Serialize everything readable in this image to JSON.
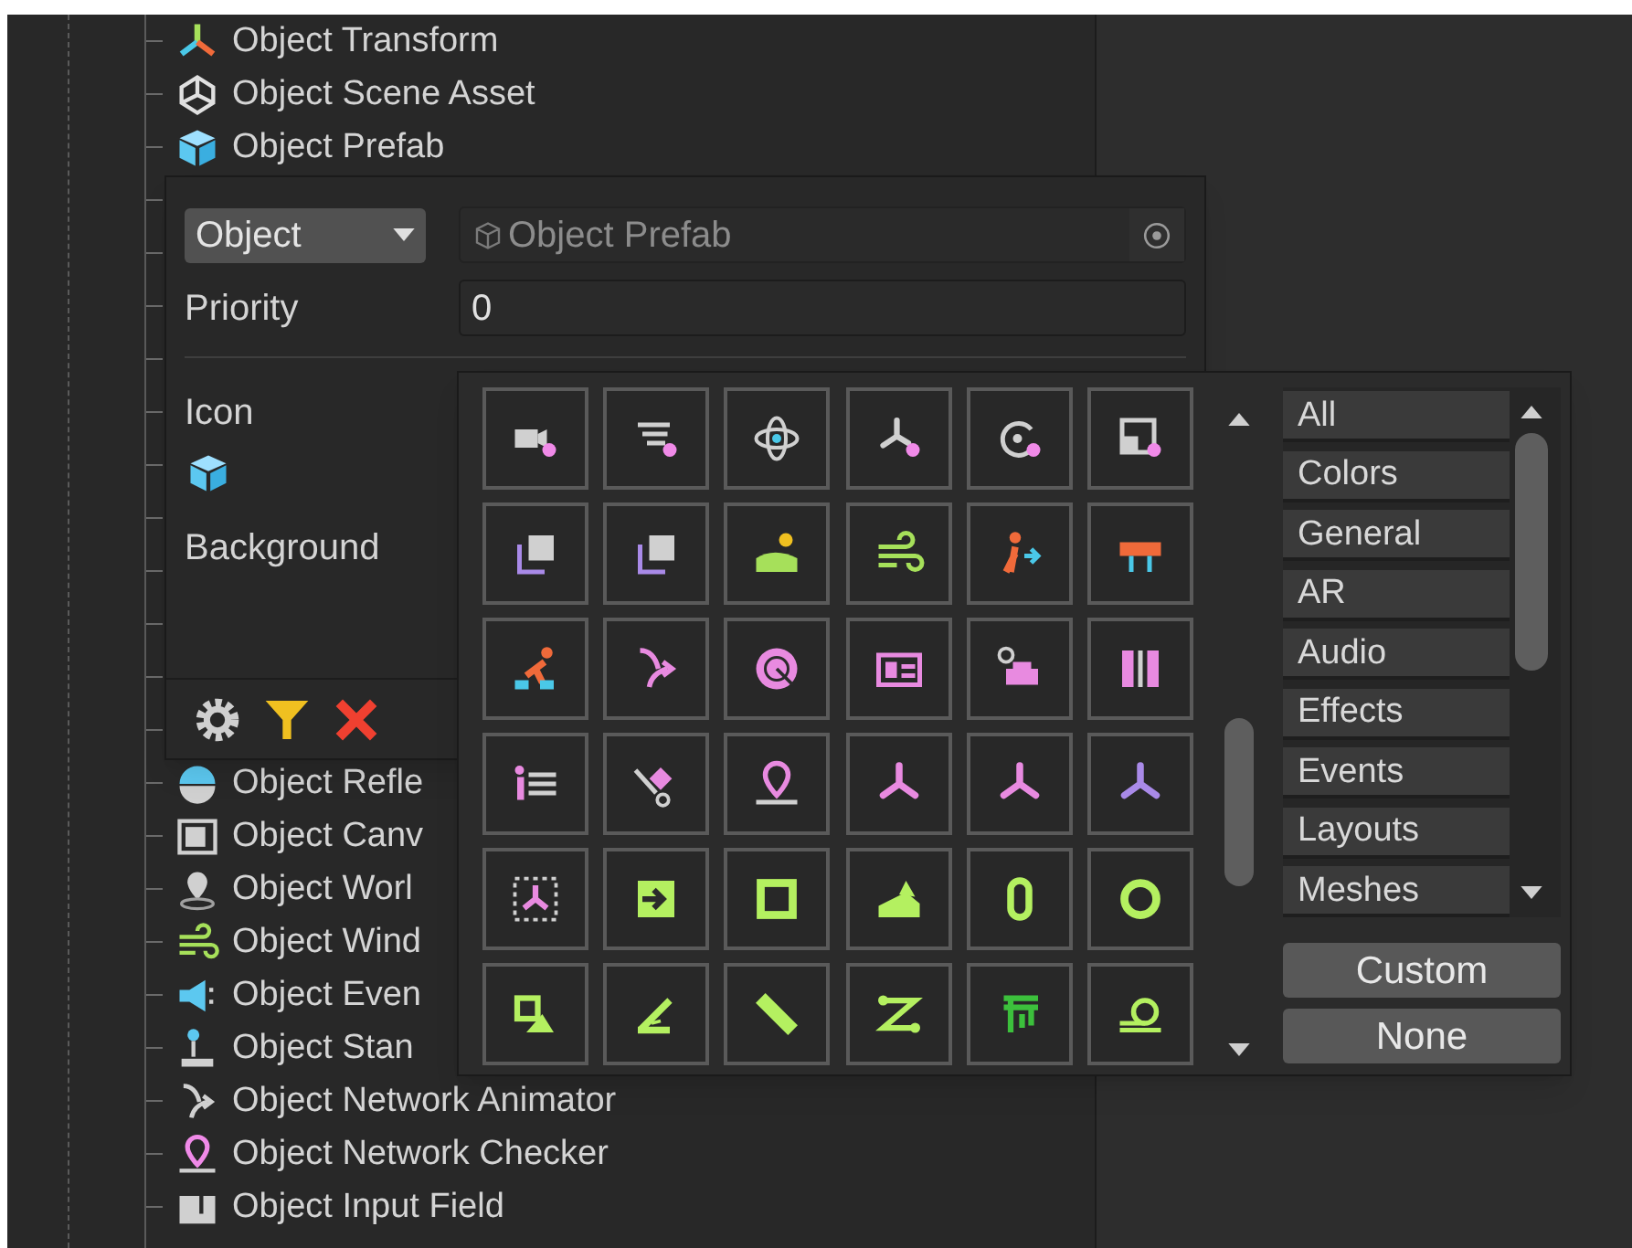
{
  "tree": {
    "rows": [
      {
        "label": "Object Transform",
        "kind": "axes"
      },
      {
        "label": "Object Scene Asset",
        "kind": "unity"
      },
      {
        "label": "Object Prefab",
        "kind": "cube"
      },
      {
        "label": "Object Refle",
        "kind": "sphere"
      },
      {
        "label": "Object Canv",
        "kind": "canvas"
      },
      {
        "label": "Object Worl",
        "kind": "worldpin"
      },
      {
        "label": "Object Wind",
        "kind": "wind"
      },
      {
        "label": "Object Even",
        "kind": "megaphone"
      },
      {
        "label": "Object Stan",
        "kind": "joystick"
      },
      {
        "label": "Object Network Animator",
        "kind": "branch"
      },
      {
        "label": "Object Network Checker",
        "kind": "mappin"
      },
      {
        "label": "Object Input Field",
        "kind": "inputfield"
      }
    ]
  },
  "inspector": {
    "type_dropdown": "Object",
    "object_field": {
      "value": "Object Prefab"
    },
    "priority": {
      "label": "Priority",
      "value": "0"
    },
    "icon_label": "Icon",
    "background_label": "Background"
  },
  "icon_picker": {
    "cells": [
      {
        "kind": "camera",
        "color": "#d0d0d0"
      },
      {
        "kind": "lines",
        "color": "#d0d0d0"
      },
      {
        "kind": "atom",
        "color": "#d0d0d0"
      },
      {
        "kind": "tripodpin",
        "color": "#d0d0d0"
      },
      {
        "kind": "rotate",
        "color": "#d0d0d0"
      },
      {
        "kind": "resize",
        "color": "#d0d0d0"
      },
      {
        "kind": "frame",
        "color": "#d0d0d0"
      },
      {
        "kind": "frame",
        "color": "#d0d0d0"
      },
      {
        "kind": "landscape",
        "color": "#a6e05a"
      },
      {
        "kind": "wind",
        "color": "#a6e05a"
      },
      {
        "kind": "walker",
        "color": "#f06a3a"
      },
      {
        "kind": "barrier",
        "color": "#f06a3a"
      },
      {
        "kind": "runner",
        "color": "#f06a3a"
      },
      {
        "kind": "branch",
        "color": "#e88ae0"
      },
      {
        "kind": "radar",
        "color": "#e88ae0"
      },
      {
        "kind": "card",
        "color": "#e88ae0"
      },
      {
        "kind": "chair",
        "color": "#e88ae0"
      },
      {
        "kind": "columns",
        "color": "#e88ae0"
      },
      {
        "kind": "list",
        "color": "#e88ae0"
      },
      {
        "kind": "cart",
        "color": "#e88ae0"
      },
      {
        "kind": "mappin",
        "color": "#e88ae0"
      },
      {
        "kind": "tripod",
        "color": "#e88ae0"
      },
      {
        "kind": "tripod",
        "color": "#e88ae0"
      },
      {
        "kind": "tripod",
        "color": "#a98ae8"
      },
      {
        "kind": "dashed",
        "color": "#e88ae0"
      },
      {
        "kind": "enter",
        "color": "#b4f060"
      },
      {
        "kind": "square",
        "color": "#b4f060"
      },
      {
        "kind": "slope",
        "color": "#b4f060"
      },
      {
        "kind": "zero",
        "color": "#b4f060"
      },
      {
        "kind": "ring",
        "color": "#b4f060"
      },
      {
        "kind": "shapes",
        "color": "#b4f060"
      },
      {
        "kind": "angle",
        "color": "#b4f060"
      },
      {
        "kind": "ruler",
        "color": "#b4f060"
      },
      {
        "kind": "zigzag",
        "color": "#b4f060"
      },
      {
        "kind": "goal",
        "color": "#3cc03c"
      },
      {
        "kind": "tape",
        "color": "#b4f060"
      }
    ],
    "categories": [
      "All",
      "Colors",
      "General",
      "AR",
      "Audio",
      "Effects",
      "Events",
      "Layouts",
      "Meshes"
    ],
    "buttons": [
      "Custom",
      "None"
    ]
  }
}
